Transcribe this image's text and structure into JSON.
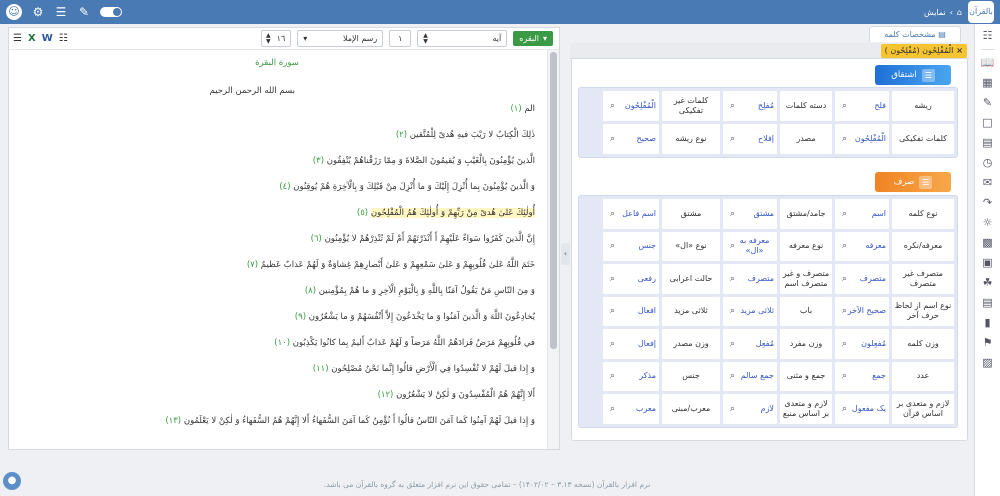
{
  "topbar": {
    "breadcrumb": "نمایش",
    "logo": "بالقرآن"
  },
  "textpanel": {
    "surah_button": "البقره",
    "ayah_label": "آیه",
    "ayah_value": "١",
    "script_label": "رسم الإملا",
    "font_size": "١٦",
    "surah_title": "سورة البقرة",
    "bismillah": "بسم الله الرحمن الرحيم",
    "verses": [
      {
        "text": "الم",
        "num": "(١)"
      },
      {
        "text": "ذٰلِكَ الْكِتابُ لا رَيْبَ فيهِ هُدىً لِلْمُتَّقين",
        "num": "(٢)"
      },
      {
        "text": "الَّذينَ يُؤْمِنُونَ بِالْغَيْبِ وَ يُقيمُونَ الصَّلاةَ وَ مِمّا رَزَقْناهُمْ يُنْفِقُون",
        "num": "(٣)"
      },
      {
        "text": "وَ الَّذينَ يُؤْمِنُونَ بِما أُنْزِلَ إِلَيْكَ وَ ما أُنْزِلَ مِنْ قَبْلِكَ وَ بِالْآخِرَةِ هُمْ يُوقِنُون",
        "num": "(٤)"
      },
      {
        "text": "أُولٰئِكَ عَلىٰ هُدىً مِنْ رَبِّهِمْ وَ أُولٰئِكَ هُمُ الْمُفْلِحُون",
        "num": "(٥)"
      },
      {
        "text": "إِنَّ الَّذينَ كَفَرُوا سَواءٌ عَلَيْهِمْ أَ أَنْذَرْتَهُمْ أَمْ لَمْ تُنْذِرْهُمْ لا يُؤْمِنُون",
        "num": "(٦)"
      },
      {
        "text": "خَتَمَ اللَّهُ عَلىٰ قُلُوبِهِمْ وَ عَلىٰ سَمْعِهِمْ وَ عَلىٰ أَبْصارِهِمْ غِشاوَةٌ وَ لَهُمْ عَذابٌ عَظيمٌ",
        "num": "(٧)"
      },
      {
        "text": "وَ مِنَ النّاسِ مَنْ يَقُولُ آمَنّا بِاللَّهِ وَ بِالْيَوْمِ الْآخِرِ وَ ما هُمْ بِمُؤْمِنين",
        "num": "(٨)"
      },
      {
        "text": "يُخادِعُونَ اللَّهَ وَ الَّذينَ آمَنُوا وَ ما يَخْدَعُونَ إِلاَّ أَنْفُسَهُمْ وَ ما يَشْعُرُون",
        "num": "(٩)"
      },
      {
        "text": "في قُلُوبِهِمْ مَرَضٌ فَزادَهُمُ اللَّهُ مَرَضاً وَ لَهُمْ عَذابٌ أَليمٌ بِما كانُوا يَكْذِبُون",
        "num": "(١٠)"
      },
      {
        "text": "وَ إِذا قيلَ لَهُمْ لا تُفْسِدُوا فِي الْأَرْضِ قالُوا إِنَّما نَحْنُ مُصْلِحُون",
        "num": "(١١)"
      },
      {
        "text": "أَلا إِنَّهُمْ هُمُ الْمُفْسِدُونَ وَ لٰكِنْ لا يَشْعُرُون",
        "num": "(١٢)"
      },
      {
        "text": "وَ إِذا قيلَ لَهُمْ آمِنُوا كَما آمَنَ النّاسُ قالُوا أَ نُؤْمِنُ كَما آمَنَ السُّفَهاءُ أَلا إِنَّهُمْ هُمُ السُّفَهاءُ وَ لٰكِنْ لا يَعْلَمُون",
        "num": "(١٣)"
      }
    ]
  },
  "wordpanel": {
    "tab_label": "مشخصات کلمه",
    "selected_word": "الْمُفْلِحُون (مُفْلِحُون )",
    "derivation": {
      "title": "اشتقاق",
      "rows": [
        [
          {
            "t": "ریشه",
            "k": "l"
          },
          {
            "t": "فلح",
            "k": "v"
          },
          {
            "t": "دسته کلمات",
            "k": "l"
          },
          {
            "t": "مُفلِح",
            "k": "v"
          },
          {
            "t": "کلمات غیر تفکیکی",
            "k": "l"
          },
          {
            "t": "الْمُفْلِحُون",
            "k": "v"
          }
        ],
        [
          {
            "t": "کلمات تفکیکی",
            "k": "l"
          },
          {
            "t": "الْمُفْلِحُون",
            "k": "v"
          },
          {
            "t": "مصدر",
            "k": "l"
          },
          {
            "t": "إفلاح",
            "k": "v"
          },
          {
            "t": "نوع ریشه",
            "k": "l"
          },
          {
            "t": "صحیح",
            "k": "v"
          }
        ]
      ]
    },
    "morphology": {
      "title": "صرف",
      "rows": [
        [
          {
            "t": "نوع کلمه",
            "k": "l"
          },
          {
            "t": "اسم",
            "k": "v"
          },
          {
            "t": "جامد/مشتق",
            "k": "l"
          },
          {
            "t": "مشتق",
            "k": "v"
          },
          {
            "t": "مشتق",
            "k": "l"
          },
          {
            "t": "اسم فاعل",
            "k": "v"
          }
        ],
        [
          {
            "t": "معرفه/نکره",
            "k": "l"
          },
          {
            "t": "معرفه",
            "k": "v"
          },
          {
            "t": "نوع معرفه",
            "k": "l"
          },
          {
            "t": "معرفه به «ال»",
            "k": "v"
          },
          {
            "t": "نوع «ال»",
            "k": "l"
          },
          {
            "t": "جنس",
            "k": "v"
          }
        ],
        [
          {
            "t": "متصرف غیر متصرف",
            "k": "l"
          },
          {
            "t": "متصرف",
            "k": "v"
          },
          {
            "t": "متصرف و غیر متصرف اسم",
            "k": "l"
          },
          {
            "t": "متصرف",
            "k": "v"
          },
          {
            "t": "حالت اعرابی",
            "k": "l"
          },
          {
            "t": "رفعی",
            "k": "v"
          }
        ],
        [
          {
            "t": "نوع اسم از لحاظ حرف آخر",
            "k": "l"
          },
          {
            "t": "صحیح الآخر",
            "k": "v"
          },
          {
            "t": "باب",
            "k": "l"
          },
          {
            "t": "ثلاثی مزید",
            "k": "v"
          },
          {
            "t": "ثلاثی مزید",
            "k": "l"
          },
          {
            "t": "افعال",
            "k": "v"
          }
        ],
        [
          {
            "t": "وزن کلمه",
            "k": "l"
          },
          {
            "t": "مُفعِلون",
            "k": "v"
          },
          {
            "t": "وزن مفرد",
            "k": "l"
          },
          {
            "t": "مُفعِل",
            "k": "v"
          },
          {
            "t": "وزن مصدر",
            "k": "l"
          },
          {
            "t": "إفعال",
            "k": "v"
          }
        ],
        [
          {
            "t": "عدد",
            "k": "l"
          },
          {
            "t": "جمع",
            "k": "v"
          },
          {
            "t": "جمع و مثنی",
            "k": "l"
          },
          {
            "t": "جمع سالم",
            "k": "v"
          },
          {
            "t": "جنس",
            "k": "l"
          },
          {
            "t": "مذکر",
            "k": "v"
          }
        ],
        [
          {
            "t": "لازم و متعدی بر اساس قرآن",
            "k": "l"
          },
          {
            "t": "یک مفعول",
            "k": "v"
          },
          {
            "t": "لازم و متعدی بر اساس منبع",
            "k": "l"
          },
          {
            "t": "لازم",
            "k": "v"
          },
          {
            "t": "معرب/مبنی",
            "k": "l"
          },
          {
            "t": "معرب",
            "k": "v"
          }
        ]
      ]
    }
  },
  "footer": {
    "text": "نرم افزار بالقرآن (نسخه ۳.۱۳ – ۱۴۰۲/۰۲) – تمامی حقوق این نرم افزار متعلق به گروه بالقرآن می باشد."
  },
  "colors": {
    "header": "#4a7ab3",
    "accent_green": "#3a9a45",
    "value_blue": "#3557c6",
    "derivation": "#1f6fd6",
    "morphology": "#f08324",
    "highlight": "#fff6c2"
  }
}
